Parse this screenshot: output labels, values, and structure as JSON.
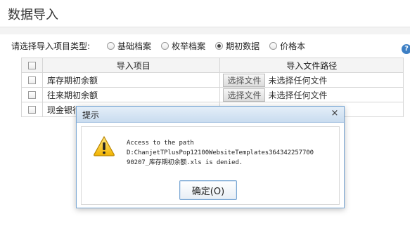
{
  "window": {
    "title": "数据导入"
  },
  "import_type": {
    "label": "请选择导入项目类型:",
    "options": [
      {
        "label": "基础档案",
        "checked": false
      },
      {
        "label": "枚举档案",
        "checked": false
      },
      {
        "label": "期初数据",
        "checked": true
      },
      {
        "label": "价格本",
        "checked": false
      }
    ]
  },
  "table": {
    "headers": [
      "导入项目",
      "导入文件路径"
    ],
    "rows": [
      {
        "item": "库存期初余额",
        "button": "选择文件",
        "status": "未选择任何文件"
      },
      {
        "item": "往来期初余额",
        "button": "选择文件",
        "status": "未选择任何文件"
      },
      {
        "item": "现金银行",
        "button": "",
        "status": ""
      }
    ]
  },
  "help": {
    "icon": "help-circle-icon",
    "glyph": "?"
  },
  "dialog": {
    "title": "提示",
    "close_glyph": "×",
    "message": "Access to the path\nD:ChanjetTPlusPop12100WebsiteTemplates364342257700\n90207_库存期初余额.xls is denied.",
    "ok_label": "确定(O)",
    "icon": "warning-icon",
    "accent": "#7aa7d4"
  }
}
